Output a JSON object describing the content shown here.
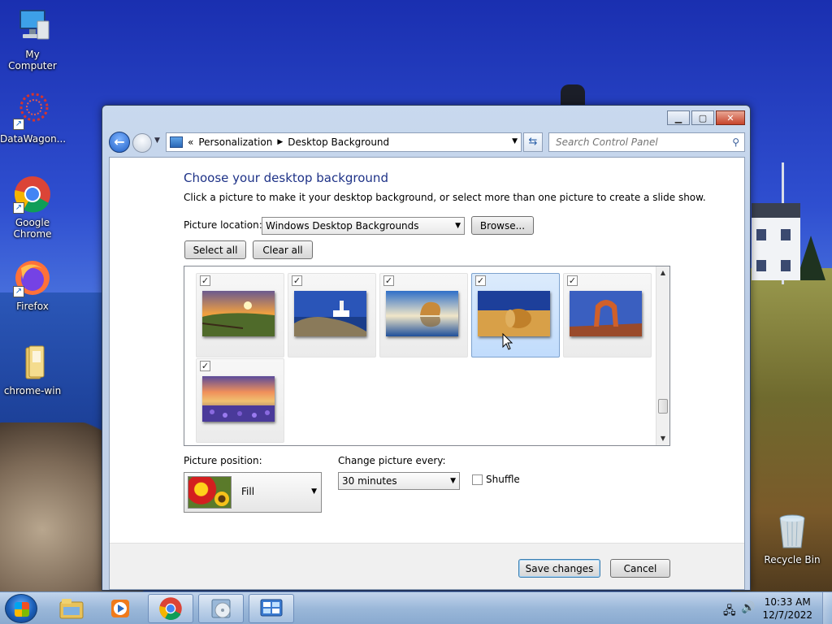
{
  "desktop": {
    "icons": [
      {
        "label": "My Computer",
        "icon": "computer-icon"
      },
      {
        "label": "DataWagon...",
        "icon": "datawagon-icon"
      },
      {
        "label": "Google Chrome",
        "icon": "chrome-icon"
      },
      {
        "label": "Firefox",
        "icon": "firefox-icon"
      },
      {
        "label": "chrome-win",
        "icon": "folder-icon"
      },
      {
        "label": "Recycle Bin",
        "icon": "recycle-bin-icon"
      }
    ]
  },
  "window": {
    "address": {
      "prefix": "«",
      "crumbs": [
        "Personalization",
        "Desktop Background"
      ]
    },
    "search": {
      "placeholder": "Search Control Panel"
    },
    "heading": "Choose your desktop background",
    "description": "Click a picture to make it your desktop background, or select more than one picture to create a slide show.",
    "picture_location": {
      "label": "Picture location:",
      "value": "Windows Desktop Backgrounds",
      "browse_label": "Browse..."
    },
    "select_all_label": "Select all",
    "clear_all_label": "Clear all",
    "thumbnails": [
      {
        "name": "sunset-fence",
        "checked": true,
        "selected": false
      },
      {
        "name": "lighthouse-coast",
        "checked": true,
        "selected": false
      },
      {
        "name": "rock-reflection",
        "checked": true,
        "selected": false
      },
      {
        "name": "hay-bale-field",
        "checked": true,
        "selected": true
      },
      {
        "name": "red-rock-arch",
        "checked": true,
        "selected": false
      },
      {
        "name": "lupine-lake-sunset",
        "checked": true,
        "selected": false
      }
    ],
    "picture_position": {
      "label": "Picture position:",
      "value": "Fill"
    },
    "change_picture": {
      "label": "Change picture every:",
      "value": "30 minutes"
    },
    "shuffle": {
      "label": "Shuffle",
      "checked": false
    },
    "save_label": "Save changes",
    "cancel_label": "Cancel"
  },
  "taskbar": {
    "pinned": [
      "explorer-icon",
      "media-player-icon",
      "chrome-icon",
      "install-disc-icon",
      "control-panel-icon"
    ],
    "clock": {
      "time": "10:33 AM",
      "date": "12/7/2022"
    }
  },
  "colors": {
    "heading": "#1e3287",
    "selection": "#c1dcfc",
    "taskbar": "#96b4d7"
  }
}
